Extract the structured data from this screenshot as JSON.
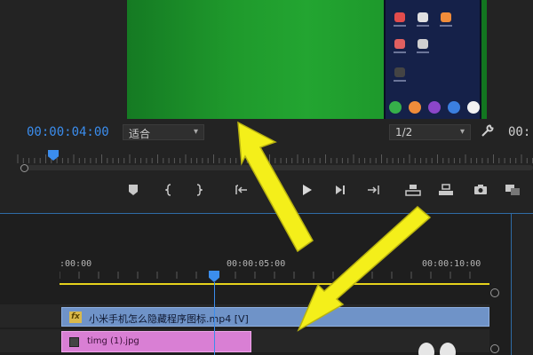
{
  "program_monitor": {
    "timecode": "00:00:04:00",
    "fit_select": "适合",
    "resolution_select": "1/2",
    "timecode_right": "00:"
  },
  "transport": {
    "buttons": [
      "add-marker",
      "mark-in",
      "mark-out",
      "go-to-in",
      "step-back",
      "play",
      "step-forward",
      "go-to-out",
      "lift",
      "extract",
      "export-frame",
      "compare"
    ]
  },
  "timeline": {
    "ruler_labels": [
      ":00:00",
      "00:00:05:00",
      "00:00:10:00"
    ],
    "video_clip": {
      "fx": "fx",
      "name": "小米手机怎么隐藏程序图标.mp4 [V]"
    },
    "image_clip": {
      "name": "timg (1).jpg"
    }
  },
  "colors": {
    "accent": "#3b8ded",
    "arrow": "#f4ef1a",
    "video_clip": "#6f93c8",
    "image_clip": "#d97fd4",
    "work_area": "#e6d21c"
  }
}
